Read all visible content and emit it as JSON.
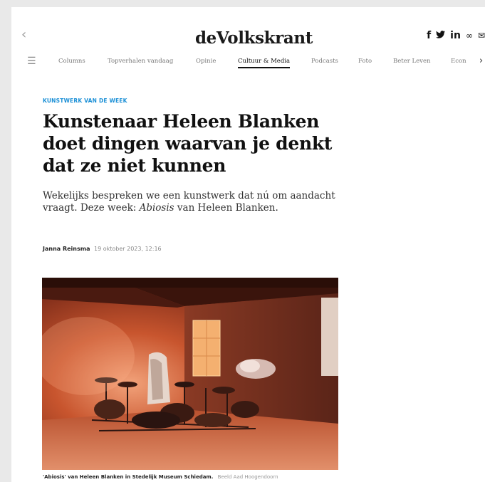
{
  "header": {
    "logo": "deVolkskrant",
    "back_icon": "chevron-left-icon",
    "share": {
      "facebook": "f",
      "twitter": "•",
      "linkedin": "in",
      "link": "∞",
      "mail": "✉"
    }
  },
  "nav": {
    "items": [
      {
        "label": "Columns"
      },
      {
        "label": "Topverhalen vandaag"
      },
      {
        "label": "Opinie"
      },
      {
        "label": "Cultuur & Media"
      },
      {
        "label": "Podcasts"
      },
      {
        "label": "Foto"
      },
      {
        "label": "Beter Leven"
      },
      {
        "label": "Econ"
      }
    ],
    "active_index": 3
  },
  "article": {
    "kicker": "KUNSTWERK VAN DE WEEK",
    "headline": "Kunstenaar Heleen Blanken doet dingen waarvan je denkt dat ze niet kunnen",
    "lead_before": "Wekelijks bespreken we een kunstwerk dat nú om aandacht vraagt. Deze week: ",
    "lead_em": "Abiosis",
    "lead_after": " van Heleen Blanken.",
    "author": "Janna Reinsma",
    "date": "19 oktober 2023, 12:16",
    "caption": "'Abiosis' van Heleen Blanken in Stedelijk Museum Schiedam.",
    "credit": "Beeld Aad Hoogendoorn"
  },
  "colors": {
    "accent": "#1a8fd6",
    "text": "#111111"
  }
}
